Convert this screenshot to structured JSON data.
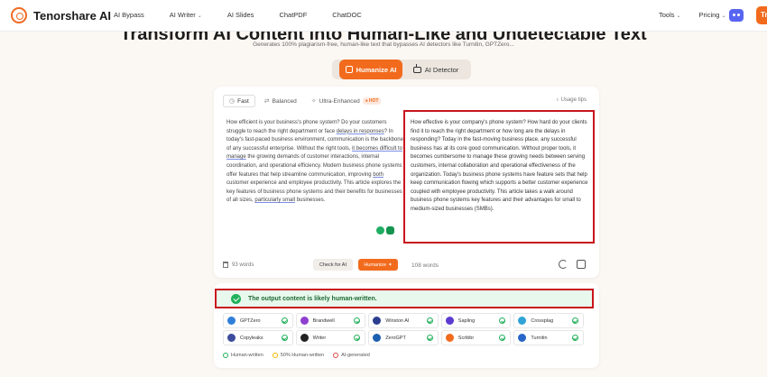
{
  "nav": {
    "brand": "Tenorshare AI",
    "links": [
      {
        "label": "AI Bypass",
        "dropdown": false
      },
      {
        "label": "AI Writer",
        "dropdown": true
      },
      {
        "label": "AI Slides",
        "dropdown": false
      },
      {
        "label": "ChatPDF",
        "dropdown": false
      },
      {
        "label": "ChatDOC",
        "dropdown": false
      }
    ],
    "right_links": [
      {
        "label": "Tools",
        "dropdown": true
      },
      {
        "label": "Pricing",
        "dropdown": true
      }
    ],
    "try_button": "Try",
    "brand_color": "#f26b1d"
  },
  "hero": {
    "title": "Transform AI Content into Human-Like and Undetectable Text",
    "subtitle": "Generates 100% plagiarism-free, human-like text that bypasses AI detectors like Turnitin, GPTZero..."
  },
  "modes": {
    "humanize": "Humanize AI",
    "detector": "AI Detector"
  },
  "editor": {
    "tabs": [
      {
        "label": "Fast",
        "icon": "clock-icon",
        "active": true
      },
      {
        "label": "Balanced",
        "icon": "balance-icon",
        "active": false
      },
      {
        "label": "Ultra-Enhanced",
        "icon": "wand-icon",
        "active": false
      }
    ],
    "hot_badge": "HOT",
    "usage_tips": "Usage tips",
    "input": {
      "p1": "How efficient is your business's phone system? Do your customers struggle to reach the right department or face ",
      "u1": "delays in responses",
      "p2": "? In today's fast-paced business environment, communication is the backbone of any successful enterprise. Without the right tools, ",
      "u2": "it becomes difficult to manage",
      "p3": " the growing demands of customer interactions, internal coordination, and operational efficiency. Modern business phone systems offer features that help streamline communication, improving ",
      "u3": "both",
      "p4": " customer experience and employee productivity. This article explores the key features of business phone systems and their benefits for businesses of all sizes, ",
      "u4": "particularly small",
      "p5": " businesses."
    },
    "input_word_count": "93 words",
    "check_button": "Check for AI",
    "humanize_button": "Humanize",
    "output_text": "How effective is your company's phone system? How hard do your clients find it to reach the right department or how long are the delays in responding? Today in the fast-moving business place, any successful business has at its core good communication. Without proper tools, it becomes cumbersome to manage these growing needs between serving customers, internal collaboration and operational effectiveness of the organization. Today's business phone systems have feature sets that help keep communication flowing which supports a better customer experience coupled with employee productivity. This article takes a walk around business phone systems key features and their advantages for small to medium-sized businesses (SMBs).",
    "output_word_count": "108 words"
  },
  "result": {
    "banner": "The output content is likely human-written.",
    "detectors_row1": [
      {
        "name": "GPTZero",
        "color": "#2f7fd8"
      },
      {
        "name": "Brandwell",
        "color": "#8e3fd0"
      },
      {
        "name": "Winston AI",
        "color": "#2b3d8f"
      },
      {
        "name": "Sapling",
        "color": "#5c3bd1"
      },
      {
        "name": "Crossplag",
        "color": "#2fa3d6"
      }
    ],
    "detectors_row2": [
      {
        "name": "Copyleaks",
        "color": "#3d4d9c"
      },
      {
        "name": "Writer",
        "color": "#222222"
      },
      {
        "name": "ZeroGPT",
        "color": "#1d5fb0"
      },
      {
        "name": "Scribbr",
        "color": "#f26b1d"
      },
      {
        "name": "Turnitin",
        "color": "#2866c9"
      }
    ],
    "legend": [
      {
        "label": "Human-written",
        "color": "#22b05b"
      },
      {
        "label": "50% Human-written",
        "color": "#f5b400"
      },
      {
        "label": "AI-generated",
        "color": "#e04646"
      }
    ]
  }
}
